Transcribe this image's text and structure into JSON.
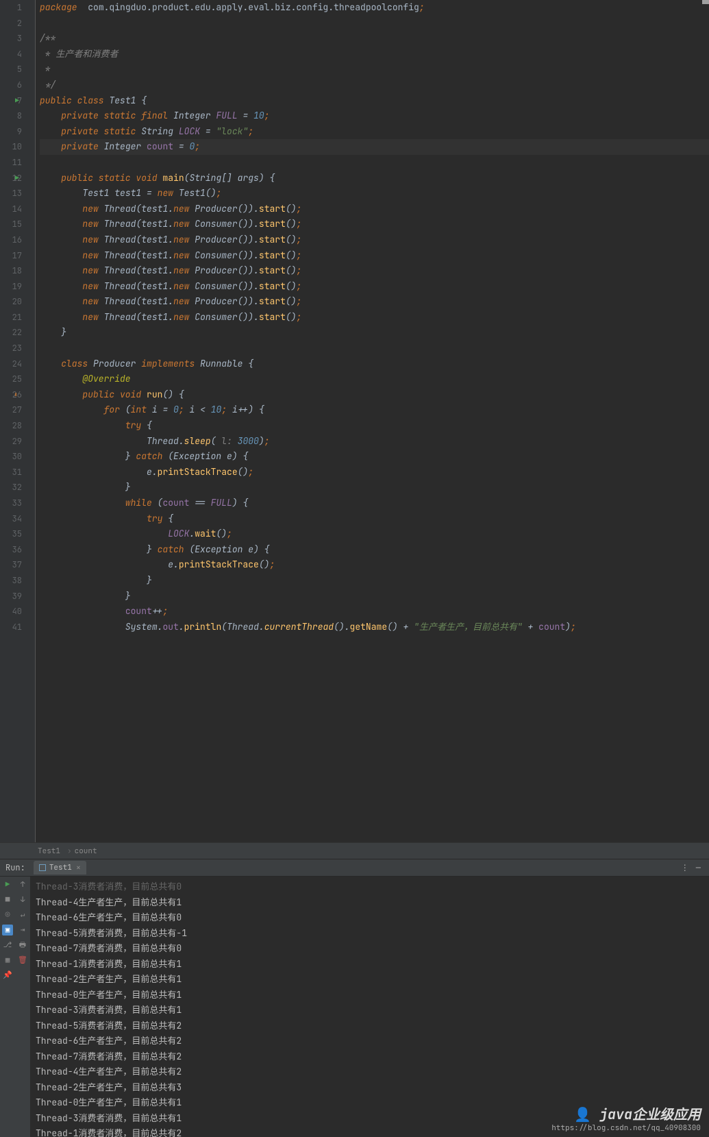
{
  "breadcrumb": {
    "a": "Test1",
    "b": "count"
  },
  "run": {
    "label": "Run:",
    "tab": "Test1"
  },
  "code": {
    "lines": [
      {
        "n": 1,
        "html": "<span class='kw'>package</span>  <span class='pkg'>com.qingduo.product.edu.apply.eval.biz.config.threadpoolconfig</span><span class='punct'>;</span>"
      },
      {
        "n": 2,
        "html": ""
      },
      {
        "n": 3,
        "html": "<span class='comment'>/**</span>"
      },
      {
        "n": 4,
        "html": "<span class='comment'> * 生产者和消费者</span>"
      },
      {
        "n": 5,
        "html": "<span class='comment'> *</span>"
      },
      {
        "n": 6,
        "html": "<span class='comment'> */</span>"
      },
      {
        "n": 7,
        "run": true,
        "html": "<span class='kw'>public class</span> <span class='cls'>Test1</span> {"
      },
      {
        "n": 8,
        "html": "    <span class='kw'>private static final</span> <span class='type'>Integer</span> <span class='static-field'>FULL</span> = <span class='num'>10</span><span class='punct'>;</span>"
      },
      {
        "n": 9,
        "html": "    <span class='kw'>private static</span> <span class='type'>String</span> <span class='static-field'>LOCK</span> = <span class='str'>\"lock\"</span><span class='punct'>;</span>"
      },
      {
        "n": 10,
        "current": true,
        "html": "    <span class='kw'>private</span> <span class='type'>Integer</span> <span class='field'>count</span> = <span class='num'>0</span><span class='punct'>;</span>"
      },
      {
        "n": 11,
        "html": ""
      },
      {
        "n": 12,
        "run": true,
        "html": "    <span class='kw'>public static void</span> <span class='method'>main</span>(<span class='type'>String</span>[] <span class='param'>args</span>) {"
      },
      {
        "n": 13,
        "html": "        <span class='type'>Test1</span> <span class='var'>test1</span> = <span class='kw'>new</span> <span class='type'>Test1</span>()<span class='punct'>;</span>"
      },
      {
        "n": 14,
        "html": "        <span class='kw'>new</span> <span class='type'>Thread</span>(<span class='var'>test1</span>.<span class='kw'>new</span> <span class='type'>Producer</span>()).<span class='method'>start</span>()<span class='punct'>;</span>"
      },
      {
        "n": 15,
        "html": "        <span class='kw'>new</span> <span class='type'>Thread</span>(<span class='var'>test1</span>.<span class='kw'>new</span> <span class='type'>Consumer</span>()).<span class='method'>start</span>()<span class='punct'>;</span>"
      },
      {
        "n": 16,
        "html": "        <span class='kw'>new</span> <span class='type'>Thread</span>(<span class='var'>test1</span>.<span class='kw'>new</span> <span class='type'>Producer</span>()).<span class='method'>start</span>()<span class='punct'>;</span>"
      },
      {
        "n": 17,
        "html": "        <span class='kw'>new</span> <span class='type'>Thread</span>(<span class='var'>test1</span>.<span class='kw'>new</span> <span class='type'>Consumer</span>()).<span class='method'>start</span>()<span class='punct'>;</span>"
      },
      {
        "n": 18,
        "html": "        <span class='kw'>new</span> <span class='type'>Thread</span>(<span class='var'>test1</span>.<span class='kw'>new</span> <span class='type'>Producer</span>()).<span class='method'>start</span>()<span class='punct'>;</span>"
      },
      {
        "n": 19,
        "html": "        <span class='kw'>new</span> <span class='type'>Thread</span>(<span class='var'>test1</span>.<span class='kw'>new</span> <span class='type'>Consumer</span>()).<span class='method'>start</span>()<span class='punct'>;</span>"
      },
      {
        "n": 20,
        "html": "        <span class='kw'>new</span> <span class='type'>Thread</span>(<span class='var'>test1</span>.<span class='kw'>new</span> <span class='type'>Producer</span>()).<span class='method'>start</span>()<span class='punct'>;</span>"
      },
      {
        "n": 21,
        "html": "        <span class='kw'>new</span> <span class='type'>Thread</span>(<span class='var'>test1</span>.<span class='kw'>new</span> <span class='type'>Consumer</span>()).<span class='method'>start</span>()<span class='punct'>;</span>"
      },
      {
        "n": 22,
        "html": "    }"
      },
      {
        "n": 23,
        "html": ""
      },
      {
        "n": 24,
        "html": "    <span class='kw'>class</span> <span class='cls'>Producer</span> <span class='kw'>implements</span> <span class='type'>Runnable</span> {"
      },
      {
        "n": 25,
        "html": "        <span class='ann'>@Override</span>"
      },
      {
        "n": 26,
        "override": true,
        "html": "        <span class='kw'>public void</span> <span class='method'>run</span>() {"
      },
      {
        "n": 27,
        "html": "            <span class='kw'>for</span> (<span class='kw'>int</span> <span class='var'>i</span> = <span class='num'>0</span><span class='punct'>;</span> <span class='var'>i</span> &lt; <span class='num'>10</span><span class='punct'>;</span> <span class='var'>i</span>++) {"
      },
      {
        "n": 28,
        "html": "                <span class='kw'>try</span> {"
      },
      {
        "n": 29,
        "html": "                    <span class='type'>Thread</span>.<span class='static-method'>sleep</span>( <span class='comment'>l:</span> <span class='num'>3000</span>)<span class='punct'>;</span>"
      },
      {
        "n": 30,
        "html": "                } <span class='kw'>catch</span> (<span class='type'>Exception</span> <span class='var'>e</span>) {"
      },
      {
        "n": 31,
        "html": "                    <span class='var'>e</span>.<span class='method'>printStackTrace</span>()<span class='punct'>;</span>"
      },
      {
        "n": 32,
        "html": "                }"
      },
      {
        "n": 33,
        "html": "                <span class='kw'>while</span> (<span class='field'>count</span> <span class='op'>==</span> <span class='static-field'>FULL</span>) {"
      },
      {
        "n": 34,
        "html": "                    <span class='kw'>try</span> {"
      },
      {
        "n": 35,
        "html": "                        <span class='static-field'>LOCK</span>.<span class='method'>wait</span>()<span class='punct'>;</span>"
      },
      {
        "n": 36,
        "html": "                    } <span class='kw'>catch</span> (<span class='type'>Exception</span> <span class='var'>e</span>) {"
      },
      {
        "n": 37,
        "html": "                        <span class='var'>e</span>.<span class='method'>printStackTrace</span>()<span class='punct'>;</span>"
      },
      {
        "n": 38,
        "html": "                    }"
      },
      {
        "n": 39,
        "html": "                }"
      },
      {
        "n": 40,
        "html": "                <span class='field'>count</span>++<span class='punct'>;</span>"
      },
      {
        "n": 41,
        "html": "                <span class='type'>System</span>.<span class='field'>out</span>.<span class='method'>println</span>(<span class='type'>Thread</span>.<span class='static-method'>currentThread</span>().<span class='method'>getName</span>() + <span class='str'>\"生产者生产，目前总共有\"</span> + <span class='field'>count</span>)<span class='punct'>;</span>"
      }
    ]
  },
  "console": [
    "Thread-3消费者消费，目前总共有0",
    "Thread-4生产者生产，目前总共有1",
    "Thread-6生产者生产，目前总共有0",
    "Thread-5消费者消费，目前总共有-1",
    "Thread-7消费者消费，目前总共有0",
    "Thread-1消费者消费，目前总共有1",
    "Thread-2生产者生产，目前总共有1",
    "Thread-0生产者生产，目前总共有1",
    "Thread-3消费者消费，目前总共有1",
    "Thread-5消费者消费，目前总共有2",
    "Thread-6生产者生产，目前总共有2",
    "Thread-7消费者消费，目前总共有2",
    "Thread-4生产者生产，目前总共有2",
    "Thread-2生产者生产，目前总共有3",
    "Thread-0生产者生产，目前总共有1",
    "Thread-3消费者消费，目前总共有1",
    "Thread-1消费者消费，目前总共有2"
  ],
  "watermark": {
    "title": "java企业级应用",
    "url": "https://blog.csdn.net/qq_40908300"
  }
}
